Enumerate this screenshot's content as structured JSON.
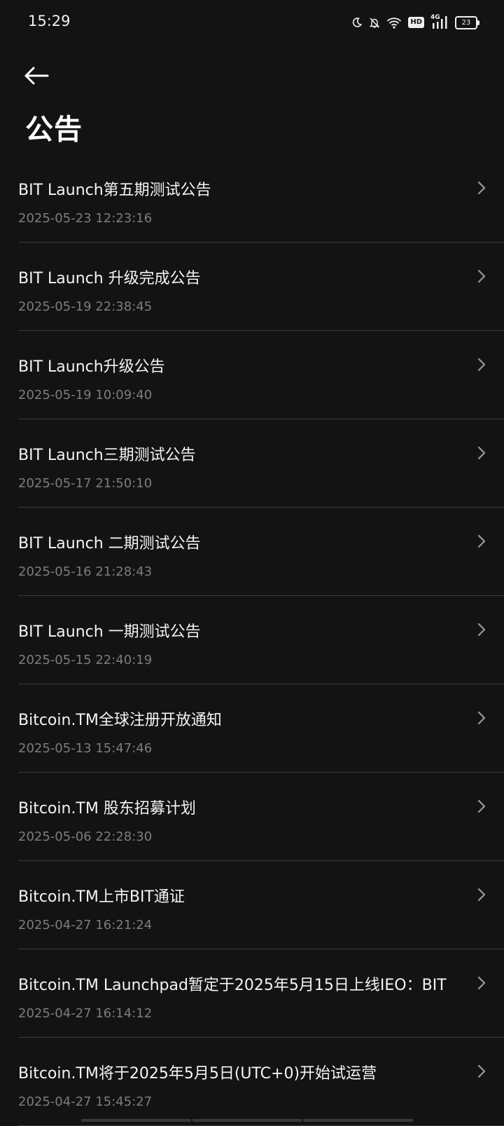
{
  "status_bar": {
    "time": "15:29",
    "hd_label": "HD",
    "network_label": "4G",
    "battery_level": "23",
    "icons": [
      "moon-icon",
      "bell-off-icon",
      "wifi-icon",
      "hd-icon",
      "signal-icon",
      "battery-icon"
    ]
  },
  "header": {
    "back_icon": "arrow-left-icon",
    "title": "公告"
  },
  "announcements": [
    {
      "title": "BIT Launch第五期测试公告",
      "date": "2025-05-23 12:23:16"
    },
    {
      "title": "BIT Launch 升级完成公告",
      "date": "2025-05-19 22:38:45"
    },
    {
      "title": "BIT Launch升级公告",
      "date": "2025-05-19 10:09:40"
    },
    {
      "title": "BIT Launch三期测试公告",
      "date": "2025-05-17 21:50:10"
    },
    {
      "title": "BIT Launch 二期测试公告",
      "date": "2025-05-16 21:28:43"
    },
    {
      "title": "BIT Launch 一期测试公告",
      "date": "2025-05-15 22:40:19"
    },
    {
      "title": "Bitcoin.TM全球注册开放通知",
      "date": "2025-05-13 15:47:46"
    },
    {
      "title": "Bitcoin.TM 股东招募计划",
      "date": "2025-05-06 22:28:30"
    },
    {
      "title": "Bitcoin.TM上市BIT通证",
      "date": "2025-04-27 16:21:24"
    },
    {
      "title": "Bitcoin.TM Launchpad暂定于2025年5月15日上线IEO：BIT",
      "date": "2025-04-27 16:14:12"
    },
    {
      "title": "Bitcoin.TM将于2025年5月5日(UTC+0)开始试运营",
      "date": "2025-04-27 15:45:27"
    }
  ],
  "colors": {
    "background": "#131313",
    "text_primary": "#f4f4f4",
    "text_secondary": "#7d7d7d",
    "divider": "#3a3a3a"
  }
}
